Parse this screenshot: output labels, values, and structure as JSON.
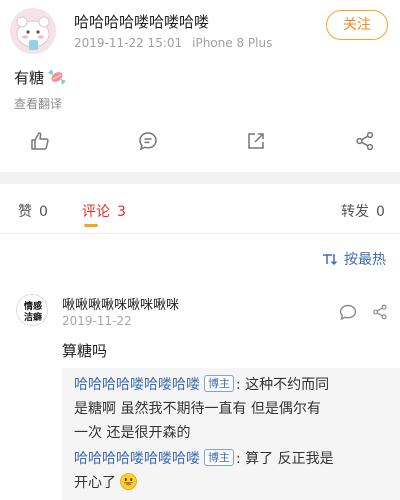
{
  "post": {
    "username": "哈哈哈哈喽哈喽哈喽",
    "timestamp": "2019-11-22 15:01",
    "device": "iPhone 8 Plus",
    "follow_label": "关注",
    "text": "有糖",
    "text_icon": "candy-icon",
    "translate_label": "查看翻译",
    "actions": [
      "like-icon",
      "comment-icon",
      "share-icon",
      "network-share-icon"
    ]
  },
  "tabs": {
    "likes": {
      "label": "赞",
      "count": "0"
    },
    "comments": {
      "label": "评论",
      "count": "3"
    },
    "reposts": {
      "label": "转发",
      "count": "0"
    },
    "sort_label": "按最热"
  },
  "comment": {
    "username": "啾啾啾啾咪啾咪啾咪",
    "date": "2019-11-22",
    "avatar_text": [
      "情感",
      "洁癖"
    ],
    "text": "算糖吗",
    "replies": [
      {
        "user": "哈哈哈哈喽哈喽哈喽",
        "badge": "博主",
        "lines": [
          ": 这种不约而同",
          "是糖啊 虽然我不期待一直有 但是偶尔有",
          "一次 还是很开森的"
        ]
      },
      {
        "user": "哈哈哈哈喽哈喽哈喽",
        "badge": "博主",
        "lines": [
          ": 算了 反正我是",
          "开心了"
        ],
        "emoji": "grinning-face-icon"
      }
    ]
  },
  "colors": {
    "accent_orange": "#f5a623",
    "comments_red": "#e0322b",
    "link_blue": "#3d6db5",
    "divider_gray": "#f2f2f2"
  }
}
